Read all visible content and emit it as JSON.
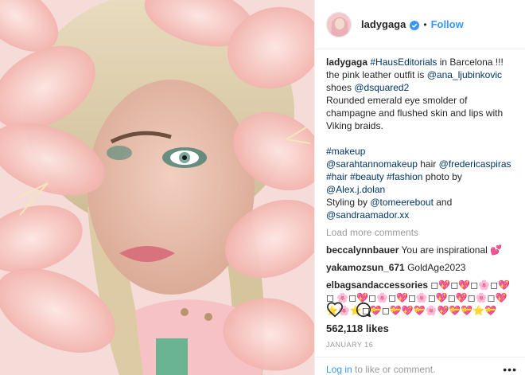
{
  "post": {
    "username": "ladygaga",
    "follow_label": "Follow",
    "dot": "•"
  },
  "caption": {
    "username": "ladygaga",
    "line1_tag": "#HausEditorials",
    "line1_text": " in Barcelona !!! the pink leather outfit is ",
    "mention1": "@ana_ljubinkovic",
    "line2_text": " shoes ",
    "mention2": "@dsquared2",
    "para2": "Rounded emerald eye smolder of champagne and flushed skin and lips with Viking braids.",
    "tag_makeup": "#makeup",
    "mention3": "@sarahtannomakeup",
    "hair_text": " hair ",
    "mention4": "@fredericaspiras",
    "tag_hair": "#hair",
    "tag_beauty": "#beauty",
    "tag_fashion": "#fashion",
    "photo_by": " photo by ",
    "mention5": "@Alex.j.dolan",
    "styling_by": "Styling by ",
    "mention6": "@tomeerebout",
    "and_text": " and ",
    "mention7": "@sandraamador.xx"
  },
  "load_more": "Load more comments",
  "comments": [
    {
      "user": "beccalynnbauer",
      "text": "You are inspirational 💕"
    },
    {
      "user": "yakamozsun_671",
      "text": "GoldAge2023"
    },
    {
      "user": "elbagsandaccessories",
      "text": "◻💖◻💖◻🌸◻💖◻ 🌸◻💖◻🌸◻💖◻🌸◻💖◻💖◻🌸◻💖 ⭐🌸⭐◻💝◻💝💖💝🌸💖💝💝⭐💝"
    }
  ],
  "likes": "562,118 likes",
  "date": "JANUARY 16",
  "footer": {
    "login": "Log in",
    "rest": " to like or comment."
  },
  "icons": {
    "heart": "heart-icon",
    "comment": "comment-bubble-icon",
    "verified": "verified-badge-icon",
    "more": "more-options-icon"
  },
  "colors": {
    "link": "#003569",
    "follow": "#3897f0",
    "muted": "#999999"
  }
}
